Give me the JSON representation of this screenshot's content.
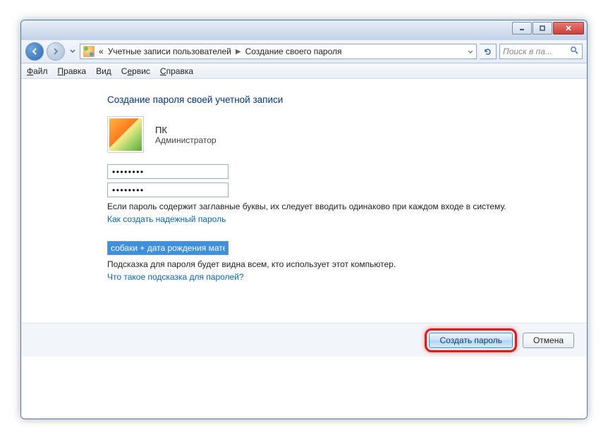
{
  "titlebar": {
    "minimize": "Minimize",
    "maximize": "Maximize",
    "close": "Close"
  },
  "address": {
    "prefix": "«",
    "crumb1": "Учетные записи пользователей",
    "crumb2": "Создание своего пароля"
  },
  "search": {
    "placeholder": "Поиск в па..."
  },
  "menu": {
    "file": "Файл",
    "edit": "Правка",
    "view": "Вид",
    "tools": "Сервис",
    "help": "Справка"
  },
  "page": {
    "title": "Создание пароля своей учетной записи",
    "user_name": "ПК",
    "user_role": "Администратор",
    "password1": "••••••••",
    "password2": "••••••••",
    "caps_hint": "Если пароль содержит заглавные буквы, их следует вводить одинаково при каждом входе в систему.",
    "link_strong": "Как создать надежный пароль",
    "hint_value": "собаки + дата рождения матери",
    "hint_note": "Подсказка для пароля будет видна всем, кто использует этот компьютер.",
    "link_hint": "Что такое подсказка для паролей?"
  },
  "footer": {
    "create": "Создать пароль",
    "cancel": "Отмена"
  }
}
